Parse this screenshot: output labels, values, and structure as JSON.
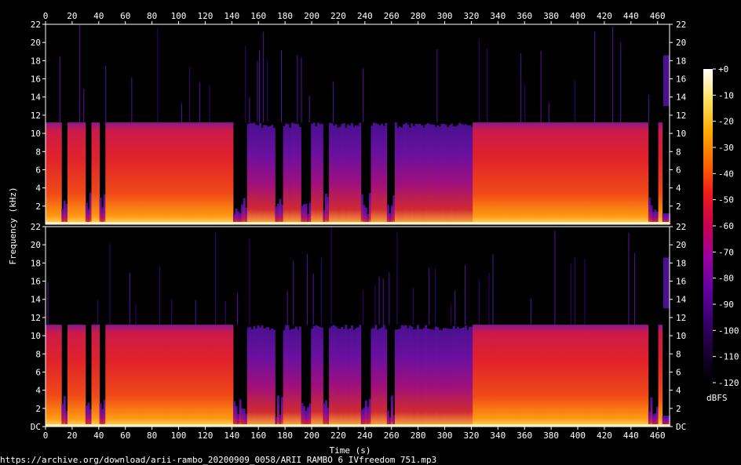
{
  "chart_data": {
    "type": "heatmap",
    "title": "",
    "xlabel": "Time (s)",
    "ylabel": "Frequency (kHz)",
    "x_ticks": [
      0,
      20,
      40,
      60,
      80,
      100,
      120,
      140,
      160,
      180,
      200,
      220,
      240,
      260,
      280,
      300,
      320,
      340,
      360,
      380,
      400,
      420,
      440,
      460
    ],
    "xlim": [
      0,
      469
    ],
    "ylim_khz": [
      0,
      22
    ],
    "y_ticks_top": [
      "22",
      "20",
      "18",
      "16",
      "14",
      "12",
      "10",
      "8",
      "6",
      "4",
      "2"
    ],
    "y_ticks_bottom": [
      "22",
      "20",
      "18",
      "16",
      "14",
      "12",
      "10",
      "8",
      "6",
      "4",
      "2",
      "DC"
    ],
    "channels": 2,
    "lowpass_cutoff_khz": 11.2,
    "colorbar": {
      "label": "dBFS",
      "ticks": [
        "+0",
        "-10",
        "-20",
        "-30",
        "-40",
        "-50",
        "-60",
        "-70",
        "-80",
        "-90",
        "-100",
        "-110",
        "-120"
      ],
      "range_db": [
        -120,
        0
      ],
      "colors": [
        "#000000",
        "#1a0033",
        "#3a0070",
        "#6600a0",
        "#9a00a0",
        "#c8004f",
        "#ee1a1a",
        "#ff6600",
        "#ffaa00",
        "#ffe060",
        "#ffffff"
      ]
    },
    "quiet_segments_s": [
      [
        12,
        16
      ],
      [
        30,
        34
      ],
      [
        40,
        44
      ],
      [
        140,
        150
      ],
      [
        172,
        178
      ],
      [
        192,
        198
      ],
      [
        208,
        212
      ],
      [
        236,
        244
      ],
      [
        256,
        262
      ],
      [
        452,
        460
      ]
    ],
    "low_energy_region_s": [
      140,
      320
    ]
  },
  "footer": {
    "source_url": "https://archive.org/download/arii-rambo_20200909_0058/ARII RAMBO 6  IVfreedom 751.mp3"
  }
}
